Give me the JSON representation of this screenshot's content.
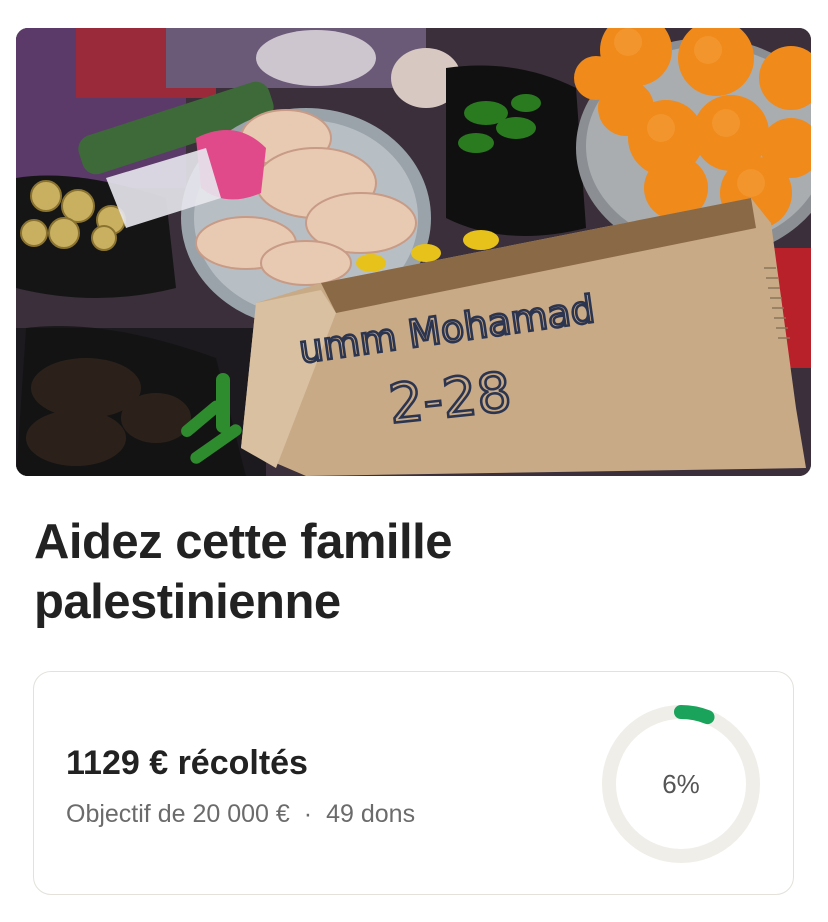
{
  "campaign": {
    "title": "Aidez cette famille palestinienne",
    "raised_label": "1129 € récoltés",
    "goal_label": "Objectif de 20 000 €",
    "separator": "·",
    "donations_label": "49 dons",
    "progress_text": "6%",
    "progress_fraction": 0.06,
    "progress_color": "#1aa35a",
    "track_color": "#f0eee8"
  },
  "photo": {
    "sign_line1": "umm Mohamad",
    "sign_line2": "2-28"
  }
}
